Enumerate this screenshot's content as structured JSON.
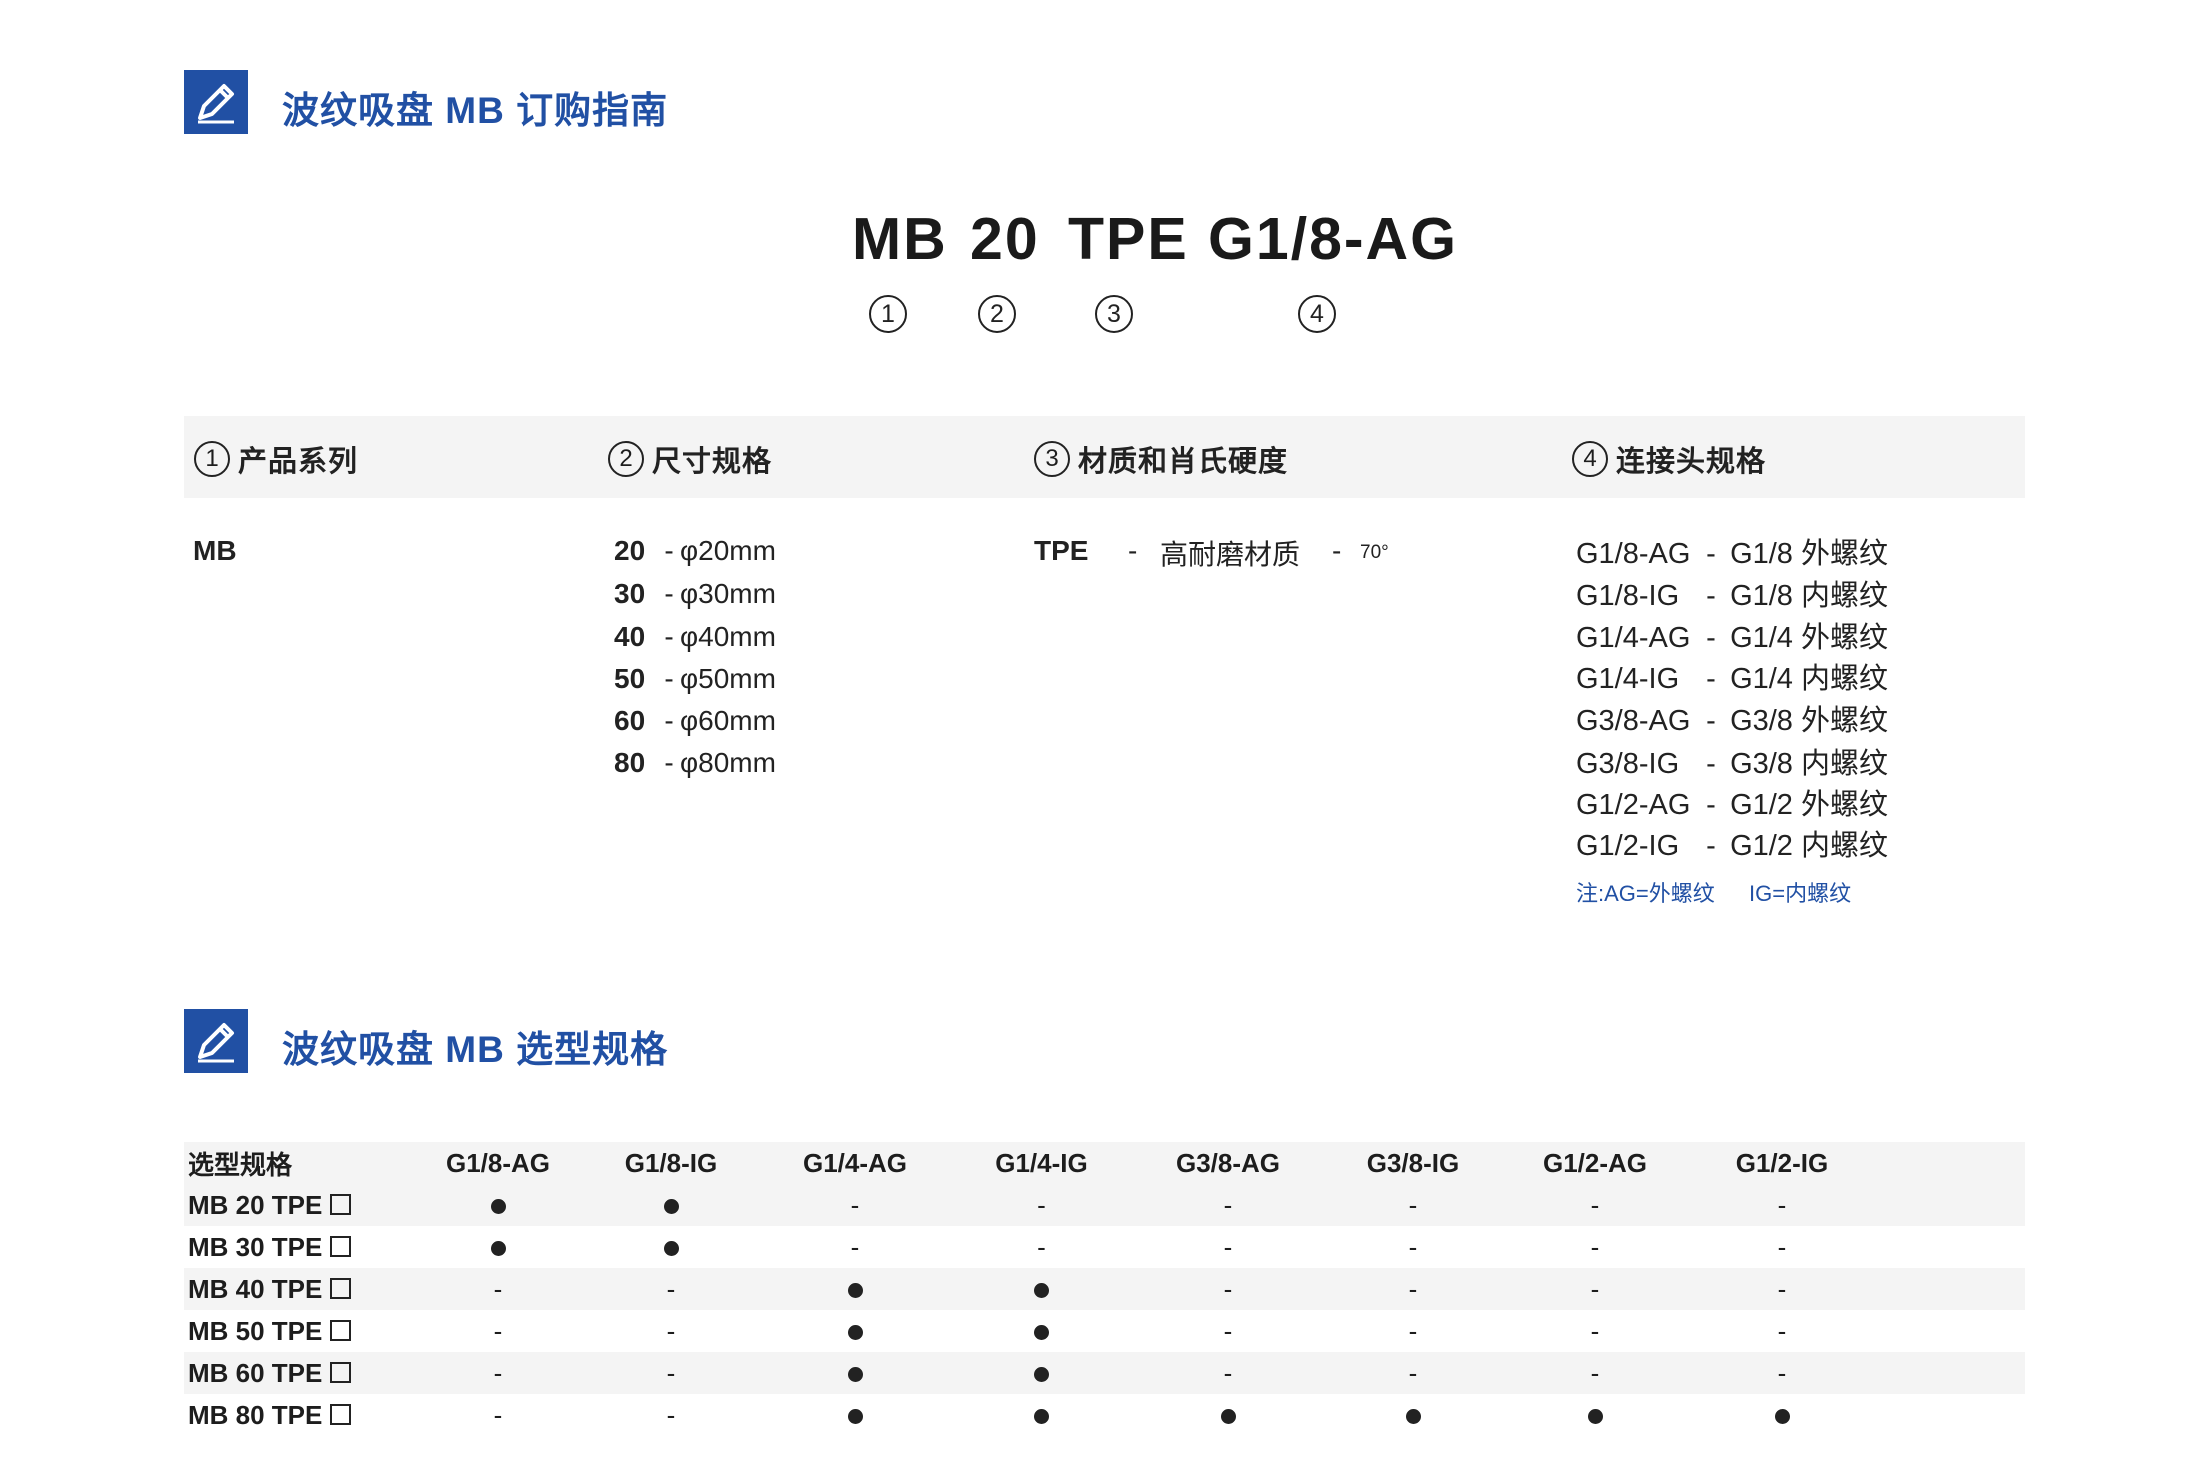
{
  "section1": {
    "title": "波纹吸盘 MB 订购指南",
    "icon": "pencil-icon"
  },
  "model_code": {
    "segments": [
      "MB",
      "20",
      "TPE",
      "G1/8-AG"
    ],
    "markers": [
      "①",
      "②",
      "③",
      "④"
    ]
  },
  "legend": {
    "headers": [
      {
        "num": "1",
        "label": "产品系列"
      },
      {
        "num": "2",
        "label": "尺寸规格"
      },
      {
        "num": "3",
        "label": "材质和肖氏硬度"
      },
      {
        "num": "4",
        "label": "连接头规格"
      }
    ],
    "series": "MB",
    "sizes": [
      {
        "code": "20",
        "desc": "φ20mm"
      },
      {
        "code": "30",
        "desc": "φ30mm"
      },
      {
        "code": "40",
        "desc": "φ40mm"
      },
      {
        "code": "50",
        "desc": "φ50mm"
      },
      {
        "code": "60",
        "desc": "φ60mm"
      },
      {
        "code": "80",
        "desc": "φ80mm"
      }
    ],
    "material": {
      "code": "TPE",
      "desc": "高耐磨材质",
      "hardness": "70°"
    },
    "connectors": [
      {
        "code": "G1/8-AG",
        "desc": "G1/8 外螺纹"
      },
      {
        "code": "G1/8-IG",
        "desc": "G1/8 内螺纹"
      },
      {
        "code": "G1/4-AG",
        "desc": "G1/4 外螺纹"
      },
      {
        "code": "G1/4-IG",
        "desc": "G1/4 内螺纹"
      },
      {
        "code": "G3/8-AG",
        "desc": "G3/8 外螺纹"
      },
      {
        "code": "G3/8-IG",
        "desc": "G3/8 内螺纹"
      },
      {
        "code": "G1/2-AG",
        "desc": "G1/2 外螺纹"
      },
      {
        "code": "G1/2-IG",
        "desc": "G1/2 内螺纹"
      }
    ],
    "note_ag": "注:AG=外螺纹",
    "note_ig": "IG=内螺纹"
  },
  "section2": {
    "title": "波纹吸盘 MB 选型规格",
    "icon": "pencil-icon"
  },
  "selection": {
    "header_label": "选型规格",
    "columns": [
      "G1/8-AG",
      "G1/8-IG",
      "G1/4-AG",
      "G1/4-IG",
      "G3/8-AG",
      "G3/8-IG",
      "G1/2-AG",
      "G1/2-IG"
    ],
    "rows": [
      {
        "model": "MB 20 TPE",
        "cells": [
          "●",
          "●",
          "-",
          "-",
          "-",
          "-",
          "-",
          "-"
        ]
      },
      {
        "model": "MB 30 TPE",
        "cells": [
          "●",
          "●",
          "-",
          "-",
          "-",
          "-",
          "-",
          "-"
        ]
      },
      {
        "model": "MB 40 TPE",
        "cells": [
          "-",
          "-",
          "●",
          "●",
          "-",
          "-",
          "-",
          "-"
        ]
      },
      {
        "model": "MB 50 TPE",
        "cells": [
          "-",
          "-",
          "●",
          "●",
          "-",
          "-",
          "-",
          "-"
        ]
      },
      {
        "model": "MB 60 TPE",
        "cells": [
          "-",
          "-",
          "●",
          "●",
          "-",
          "-",
          "-",
          "-"
        ]
      },
      {
        "model": "MB 80 TPE",
        "cells": [
          "-",
          "-",
          "●",
          "●",
          "●",
          "●",
          "●",
          "●"
        ]
      }
    ]
  },
  "colors": {
    "accent": "#2150a4",
    "shade": "#f4f4f4",
    "text": "#1d1d1d"
  }
}
